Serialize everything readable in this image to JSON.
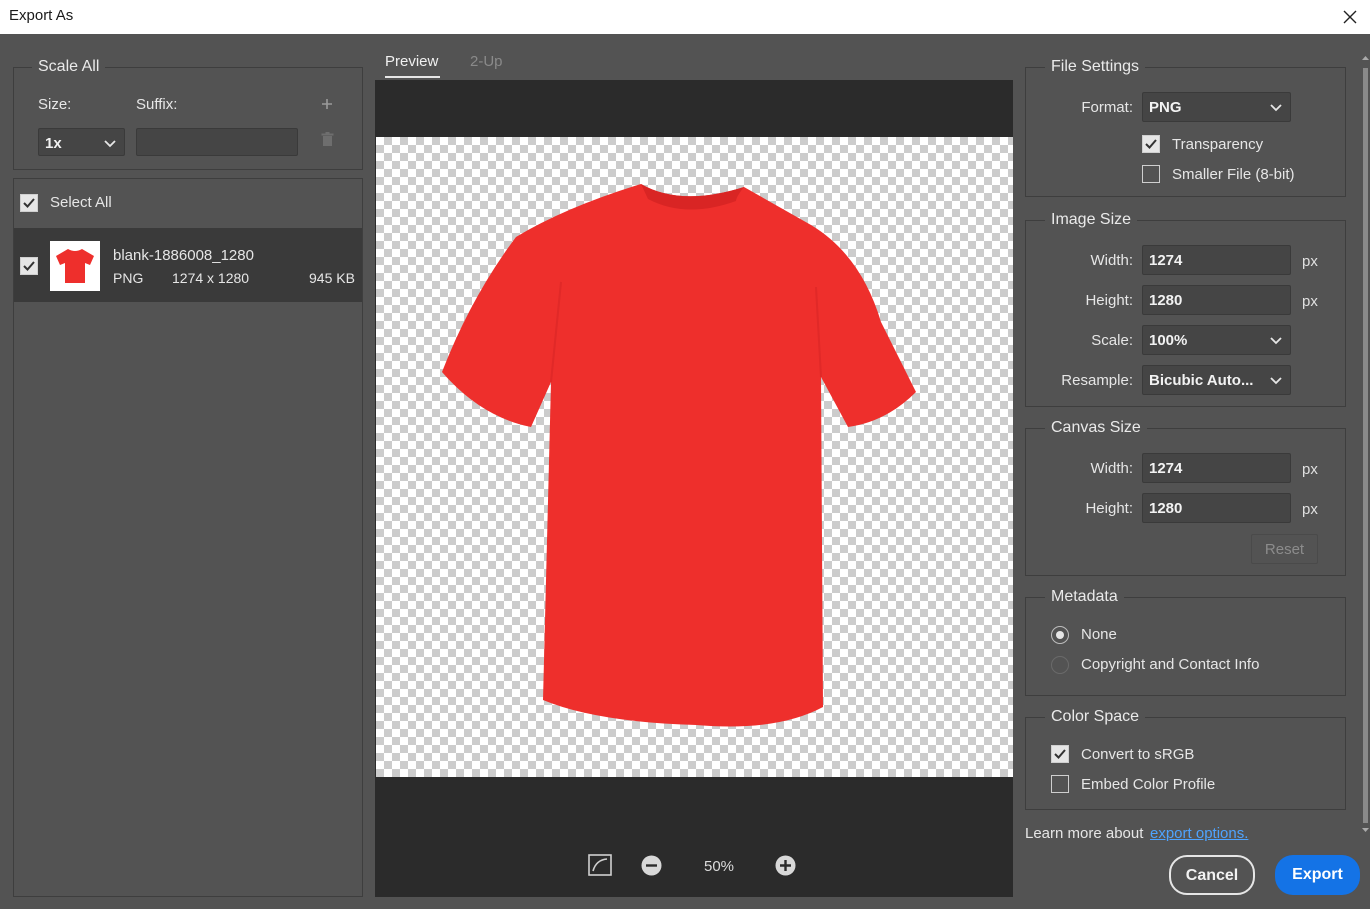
{
  "window": {
    "title": "Export As"
  },
  "scale_all": {
    "legend": "Scale All",
    "size_label": "Size:",
    "suffix_label": "Suffix:",
    "size_value": "1x",
    "suffix_value": ""
  },
  "asset_list": {
    "select_all_label": "Select All",
    "items": [
      {
        "name": "blank-1886008_1280",
        "format": "PNG",
        "dimensions": "1274 x 1280",
        "file_size": "945 KB",
        "checked": true
      }
    ]
  },
  "preview": {
    "tabs": [
      {
        "label": "Preview",
        "active": true
      },
      {
        "label": "2-Up",
        "active": false
      }
    ],
    "zoom": "50%",
    "shirt_color": "#ee2f2c"
  },
  "file_settings": {
    "legend": "File Settings",
    "format_label": "Format:",
    "format_value": "PNG",
    "transparency_label": "Transparency",
    "transparency_checked": true,
    "smaller_file_label": "Smaller File (8-bit)",
    "smaller_file_checked": false
  },
  "image_size": {
    "legend": "Image Size",
    "width_label": "Width:",
    "width_value": "1274",
    "height_label": "Height:",
    "height_value": "1280",
    "unit": "px",
    "scale_label": "Scale:",
    "scale_value": "100%",
    "resample_label": "Resample:",
    "resample_value": "Bicubic Auto..."
  },
  "canvas_size": {
    "legend": "Canvas Size",
    "width_label": "Width:",
    "width_value": "1274",
    "height_label": "Height:",
    "height_value": "1280",
    "unit": "px",
    "reset_label": "Reset"
  },
  "metadata": {
    "legend": "Metadata",
    "options": [
      {
        "label": "None",
        "selected": true
      },
      {
        "label": "Copyright and Contact Info",
        "selected": false
      }
    ]
  },
  "color_space": {
    "legend": "Color Space",
    "convert_label": "Convert to sRGB",
    "convert_checked": true,
    "embed_label": "Embed Color Profile",
    "embed_checked": false
  },
  "footer": {
    "learn_more_text": "Learn more about",
    "learn_more_link": "export options.",
    "cancel_label": "Cancel",
    "export_label": "Export"
  },
  "colors": {
    "accent": "#1473e6",
    "link": "#4ea3ff",
    "panel": "#535353",
    "canvas_dark": "#2b2b2b"
  }
}
